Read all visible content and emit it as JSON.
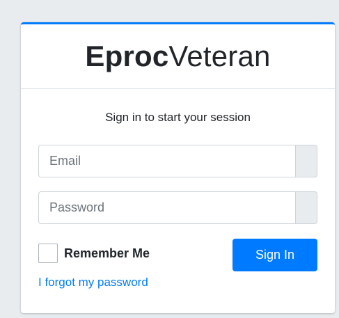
{
  "brand": {
    "bold": "Eproc",
    "light": "Veteran"
  },
  "login": {
    "message": "Sign in to start your session",
    "email_placeholder": "Email",
    "password_placeholder": "Password",
    "remember_label": "Remember Me",
    "signin_label": "Sign In",
    "forgot_label": "I forgot my password"
  },
  "colors": {
    "primary": "#007bff",
    "background": "#e9ecef",
    "card": "#ffffff"
  }
}
